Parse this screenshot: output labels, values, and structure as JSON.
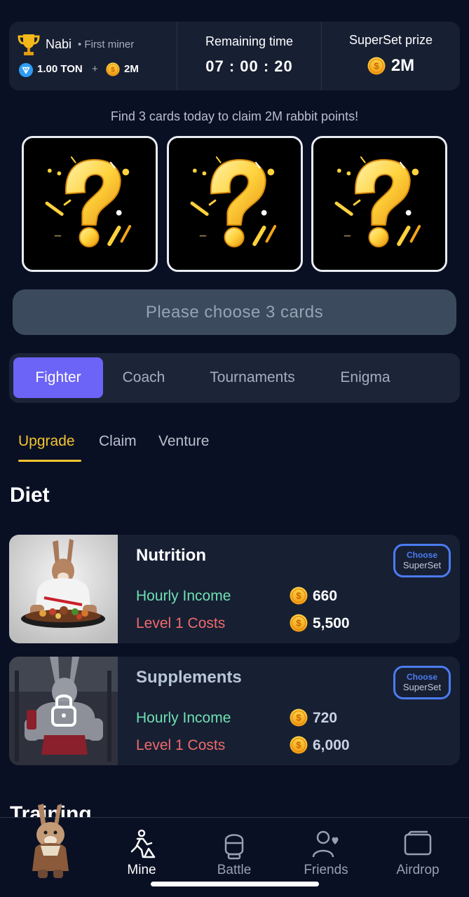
{
  "user": {
    "name": "Nabi",
    "rank": "• First miner",
    "ton": "1.00 TON",
    "plus": "+",
    "coins": "2M"
  },
  "timer": {
    "label": "Remaining time",
    "value": "07 : 00 : 20"
  },
  "prize": {
    "label": "SuperSet prize",
    "value": "2M"
  },
  "hint": "Find 3 cards today to claim 2M rabbit points!",
  "choose_button": "Please choose 3 cards",
  "main_tabs": [
    "Fighter",
    "Coach",
    "Tournaments",
    "Enigma"
  ],
  "sub_tabs": [
    "Upgrade",
    "Claim",
    "Venture"
  ],
  "sections": [
    "Diet",
    "Training"
  ],
  "cards": [
    {
      "title": "Nutrition",
      "superset_top": "Choose",
      "superset_bottom": "SuperSet",
      "income_label": "Hourly Income",
      "income": "660",
      "cost_label": "Level 1 Costs",
      "cost": "5,500",
      "locked": false
    },
    {
      "title": "Supplements",
      "superset_top": "Choose",
      "superset_bottom": "SuperSet",
      "income_label": "Hourly Income",
      "income": "720",
      "cost_label": "Level 1 Costs",
      "cost": "6,000",
      "locked": true
    }
  ],
  "nav": [
    "Mine",
    "Battle",
    "Friends",
    "Airdrop"
  ],
  "colors": {
    "accent": "#6c63f7",
    "gold": "#f4c430",
    "income": "#6fe0b2",
    "cost": "#ef6b6b",
    "superset": "#4b7cf0"
  },
  "icons": [
    "trophy-icon",
    "ton-icon",
    "coin-icon",
    "question-mark-icon",
    "lock-icon",
    "rabbit-avatar-icon",
    "mine-icon",
    "battle-icon",
    "friends-icon",
    "airdrop-icon"
  ]
}
